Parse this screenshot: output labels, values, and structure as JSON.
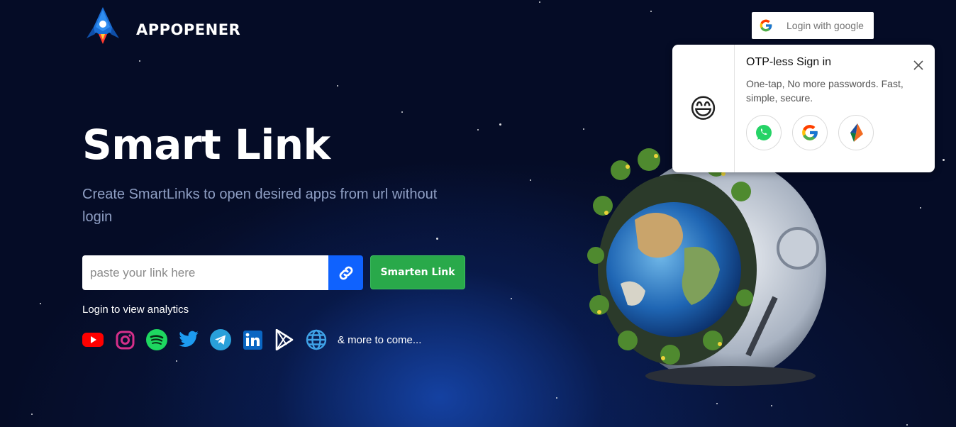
{
  "header": {
    "brand_name": "APPOPENER",
    "google_login_label": "Login with google"
  },
  "hero": {
    "title": "Smart Link",
    "subtitle": "Create SmartLinks to open desired apps from url without login"
  },
  "link_form": {
    "placeholder": "paste your link here",
    "submit_label": "Smarten Link"
  },
  "analytics_text": "Login to view analytics",
  "supported_apps": {
    "icons": [
      "youtube-icon",
      "instagram-icon",
      "spotify-icon",
      "twitter-icon",
      "telegram-icon",
      "linkedin-icon",
      "play-store-icon",
      "web-icon"
    ],
    "more_text": "& more to come..."
  },
  "otp_popup": {
    "title": "OTP-less Sign in",
    "description": "One-tap, No more passwords. Fast, simple, secure.",
    "options": [
      "whatsapp-icon",
      "google-icon",
      "truecaller-icon"
    ],
    "emoji": "😄"
  },
  "colors": {
    "background": "#050c26",
    "link_button": "#0f62fe",
    "smarten_button": "#29a94a",
    "subtitle_text": "#8f9fc4"
  }
}
